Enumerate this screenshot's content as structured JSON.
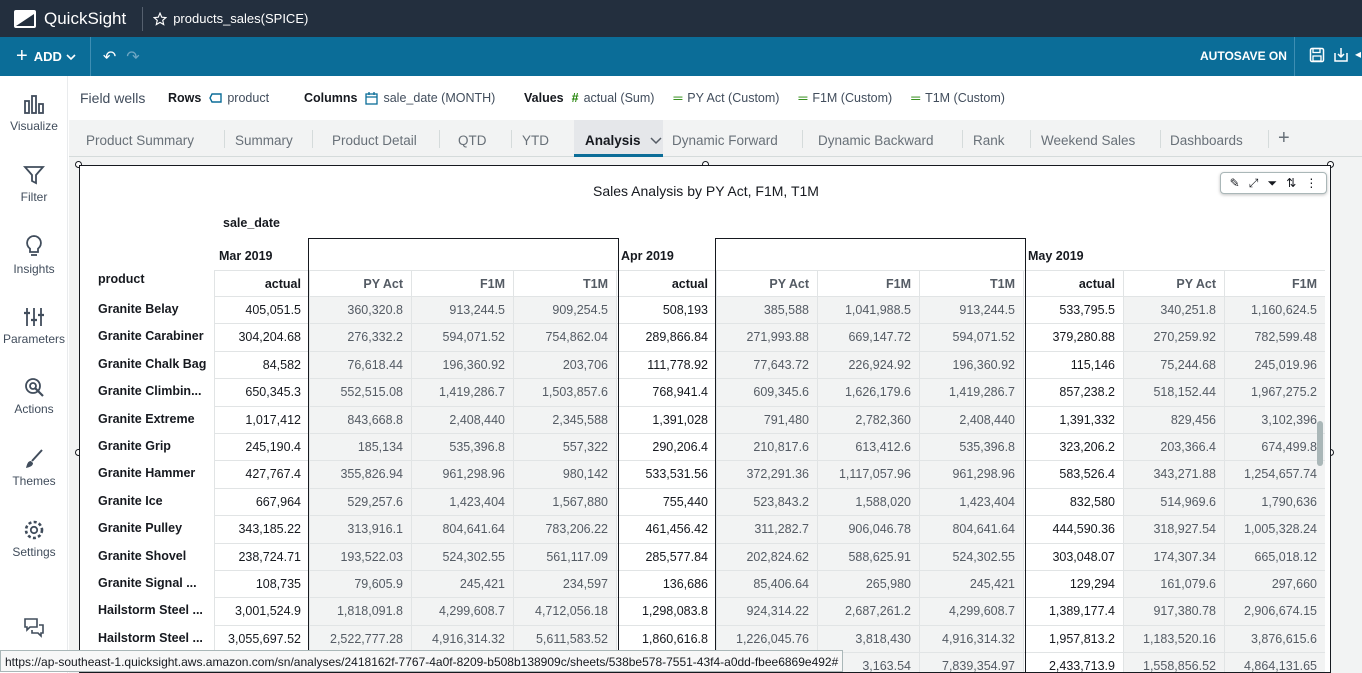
{
  "app": {
    "name": "QuickSight",
    "analysis_title": "products_sales(SPICE)"
  },
  "actionbar": {
    "add_label": "ADD",
    "autosave_label": "AUTOSAVE ON"
  },
  "sidebar": {
    "items": [
      {
        "label": "Visualize",
        "icon": "visualize-icon"
      },
      {
        "label": "Filter",
        "icon": "filter-icon"
      },
      {
        "label": "Insights",
        "icon": "insights-icon"
      },
      {
        "label": "Parameters",
        "icon": "parameters-icon"
      },
      {
        "label": "Actions",
        "icon": "actions-icon"
      },
      {
        "label": "Themes",
        "icon": "themes-icon"
      },
      {
        "label": "Settings",
        "icon": "settings-icon"
      }
    ]
  },
  "fieldwells": {
    "title": "Field wells",
    "rows_label": "Rows",
    "rows_value": "product",
    "columns_label": "Columns",
    "columns_value": "sale_date (MONTH)",
    "values_label": "Values",
    "values": [
      "actual (Sum)",
      "PY Act (Custom)",
      "F1M (Custom)",
      "T1M (Custom)"
    ]
  },
  "tabs": [
    "Product Summary",
    "Summary",
    "Product Detail",
    "QTD",
    "YTD",
    "Analysis",
    "Dynamic Forward",
    "Dynamic Backward",
    "Rank",
    "Weekend Sales",
    "Dashboards"
  ],
  "active_tab": "Analysis",
  "visual": {
    "title": "Sales Analysis by PY Act, F1M, T1M",
    "column_field": "sale_date",
    "row_field": "product",
    "months": [
      "Mar 2019",
      "Apr 2019",
      "May 2019"
    ],
    "measures": [
      "actual",
      "PY Act",
      "F1M",
      "T1M"
    ],
    "rows": [
      {
        "product": "Granite Belay",
        "values": [
          "405,051.5",
          "360,320.8",
          "913,244.5",
          "909,254.5",
          "508,193",
          "385,588",
          "1,041,988.5",
          "913,244.5",
          "533,795.5",
          "340,251.8",
          "1,160,624.5"
        ]
      },
      {
        "product": "Granite Carabiner",
        "values": [
          "304,204.68",
          "276,332.2",
          "594,071.52",
          "754,862.04",
          "289,866.84",
          "271,993.88",
          "669,147.72",
          "594,071.52",
          "379,280.88",
          "270,259.92",
          "782,599.48"
        ]
      },
      {
        "product": "Granite Chalk Bag",
        "values": [
          "84,582",
          "76,618.44",
          "196,360.92",
          "203,706",
          "111,778.92",
          "77,643.72",
          "226,924.92",
          "196,360.92",
          "115,146",
          "75,244.68",
          "245,019.96"
        ]
      },
      {
        "product": "Granite Climbin...",
        "values": [
          "650,345.3",
          "552,515.08",
          "1,419,286.7",
          "1,503,857.6",
          "768,941.4",
          "609,345.6",
          "1,626,179.6",
          "1,419,286.7",
          "857,238.2",
          "518,152.44",
          "1,967,275.2"
        ]
      },
      {
        "product": "Granite Extreme",
        "values": [
          "1,017,412",
          "843,668.8",
          "2,408,440",
          "2,345,588",
          "1,391,028",
          "791,480",
          "2,782,360",
          "2,408,440",
          "1,391,332",
          "829,456",
          "3,102,396"
        ]
      },
      {
        "product": "Granite Grip",
        "values": [
          "245,190.4",
          "185,134",
          "535,396.8",
          "557,322",
          "290,206.4",
          "210,817.6",
          "613,412.6",
          "535,396.8",
          "323,206.2",
          "203,366.4",
          "674,499.8"
        ]
      },
      {
        "product": "Granite Hammer",
        "values": [
          "427,767.4",
          "355,826.94",
          "961,298.96",
          "980,142",
          "533,531.56",
          "372,291.36",
          "1,117,057.96",
          "961,298.96",
          "583,526.4",
          "343,271.88",
          "1,254,657.74"
        ]
      },
      {
        "product": "Granite Ice",
        "values": [
          "667,964",
          "529,257.6",
          "1,423,404",
          "1,567,880",
          "755,440",
          "523,843.2",
          "1,588,020",
          "1,423,404",
          "832,580",
          "514,969.6",
          "1,790,636"
        ]
      },
      {
        "product": "Granite Pulley",
        "values": [
          "343,185.22",
          "313,916.1",
          "804,641.64",
          "783,206.22",
          "461,456.42",
          "311,282.7",
          "906,046.78",
          "804,641.64",
          "444,590.36",
          "318,927.54",
          "1,005,328.24"
        ]
      },
      {
        "product": "Granite Shovel",
        "values": [
          "238,724.71",
          "193,522.03",
          "524,302.55",
          "561,117.09",
          "285,577.84",
          "202,824.62",
          "588,625.91",
          "524,302.55",
          "303,048.07",
          "174,307.34",
          "665,018.12"
        ]
      },
      {
        "product": "Granite Signal ...",
        "values": [
          "108,735",
          "79,605.9",
          "245,421",
          "234,597",
          "136,686",
          "85,406.64",
          "265,980",
          "245,421",
          "129,294",
          "161,079.6",
          "297,660"
        ]
      },
      {
        "product": "Hailstorm Steel ...",
        "values": [
          "3,001,524.9",
          "1,818,091.8",
          "4,299,608.7",
          "4,712,056.18",
          "1,298,083.8",
          "924,314.22",
          "2,687,261.2",
          "4,299,608.7",
          "1,389,177.4",
          "917,380.78",
          "2,906,674.15"
        ]
      },
      {
        "product": "Hailstorm Steel ...",
        "values": [
          "3,055,697.52",
          "2,522,777.28",
          "4,916,314.32",
          "5,611,583.52",
          "1,860,616.8",
          "1,226,045.76",
          "3,818,430",
          "4,916,314.32",
          "1,957,813.2",
          "1,183,520.16",
          "3,876,615.6"
        ]
      },
      {
        "product": "",
        "values": [
          "",
          "",
          "",
          "",
          "",
          "",
          "3,163.54",
          "7,839,354.97",
          "2,433,713.9",
          "1,558,856.52",
          "4,864,131.65"
        ]
      }
    ]
  },
  "status_url": "https://ap-southeast-1.quicksight.aws.amazon.com/sn/analyses/2418162f-7767-4a0f-8209-b508b138909c/sheets/538be578-7551-43f4-a0dd-fbee6869e492#"
}
